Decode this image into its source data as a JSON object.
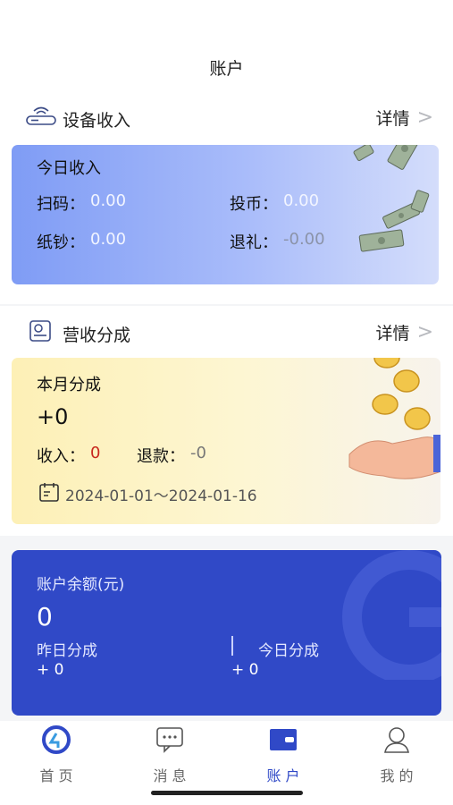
{
  "header": {
    "title": "账户"
  },
  "device_income": {
    "title": "设备收入",
    "detail_label": "详情",
    "chevron": ">",
    "card": {
      "title": "今日收入",
      "scan_label": "扫码：",
      "scan_value": "0.00",
      "coin_label": "投币：",
      "coin_value": "0.00",
      "note_label": "纸钞：",
      "note_value": "0.00",
      "gift_label": "退礼：",
      "gift_value": "-0.00"
    },
    "icon": "wifi-router-icon"
  },
  "revenue_share": {
    "title": "营收分成",
    "detail_label": "详情",
    "chevron": ">",
    "card": {
      "title": "本月分成",
      "amount": "+0",
      "income_label": "收入：",
      "income_value": "0",
      "refund_label": "退款：",
      "refund_value": "-0",
      "date_range": "2024-01-01～2024-01-16"
    },
    "icon": "report-icon"
  },
  "balance": {
    "title": "账户余额(元)",
    "amount": "0",
    "yesterday_label": "昨日分成",
    "yesterday_value": "+ 0",
    "today_label": "今日分成",
    "today_value": "+ 0"
  },
  "tabbar": {
    "items": [
      {
        "label": "首 页",
        "icon": "home-logo-icon"
      },
      {
        "label": "消 息",
        "icon": "message-icon"
      },
      {
        "label": "账 户",
        "icon": "wallet-icon"
      },
      {
        "label": "我 的",
        "icon": "user-icon"
      }
    ],
    "active_index": 2
  },
  "colors": {
    "primary": "#3049c7",
    "income_value_red": "#c8281e",
    "card_blue": "#7f9cf5",
    "card_yellow": "#fdf0b6"
  }
}
